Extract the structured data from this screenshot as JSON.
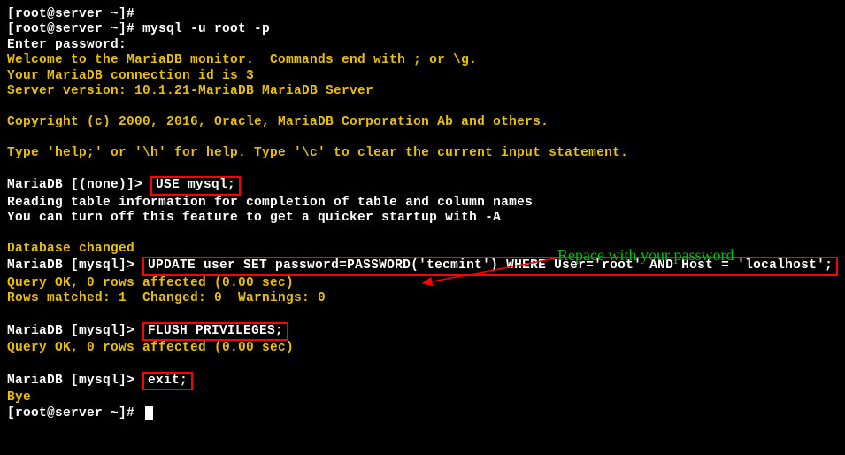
{
  "lines": {
    "l01": "[root@server ~]# ",
    "l02_prompt": "[root@server ~]# ",
    "l02_cmd": "mysql -u root -p",
    "l03": "Enter password:",
    "l04": "Welcome to the MariaDB monitor.  Commands end with ; or \\g.",
    "l05": "Your MariaDB connection id is 3",
    "l06": "Server version: 10.1.21-MariaDB MariaDB Server",
    "l07": "Copyright (c) 2000, 2016, Oracle, MariaDB Corporation Ab and others.",
    "l08": "Type 'help;' or '\\h' for help. Type '\\c' to clear the current input statement.",
    "l09_prompt": "MariaDB [(none)]> ",
    "l09_cmd": "USE mysql;",
    "l10": "Reading table information for completion of table and column names",
    "l11": "You can turn off this feature to get a quicker startup with -A",
    "l12": "Database changed",
    "l13_prompt": "MariaDB [mysql]> ",
    "l13_cmd": "UPDATE user SET password=PASSWORD('tecmint') WHERE User='root' AND Host = 'localhost';",
    "l14": "Query OK, 0 rows affected (0.00 sec)",
    "l15": "Rows matched: 1  Changed: 0  Warnings: 0",
    "l16_prompt": "MariaDB [mysql]> ",
    "l16_cmd": "FLUSH PRIVILEGES;",
    "l17": "Query OK, 0 rows affected (0.00 sec)",
    "l18_prompt": "MariaDB [mysql]> ",
    "l18_cmd": "exit;",
    "l19": "Bye",
    "l20": "[root@server ~]# "
  },
  "annotation": "Repace with your password"
}
